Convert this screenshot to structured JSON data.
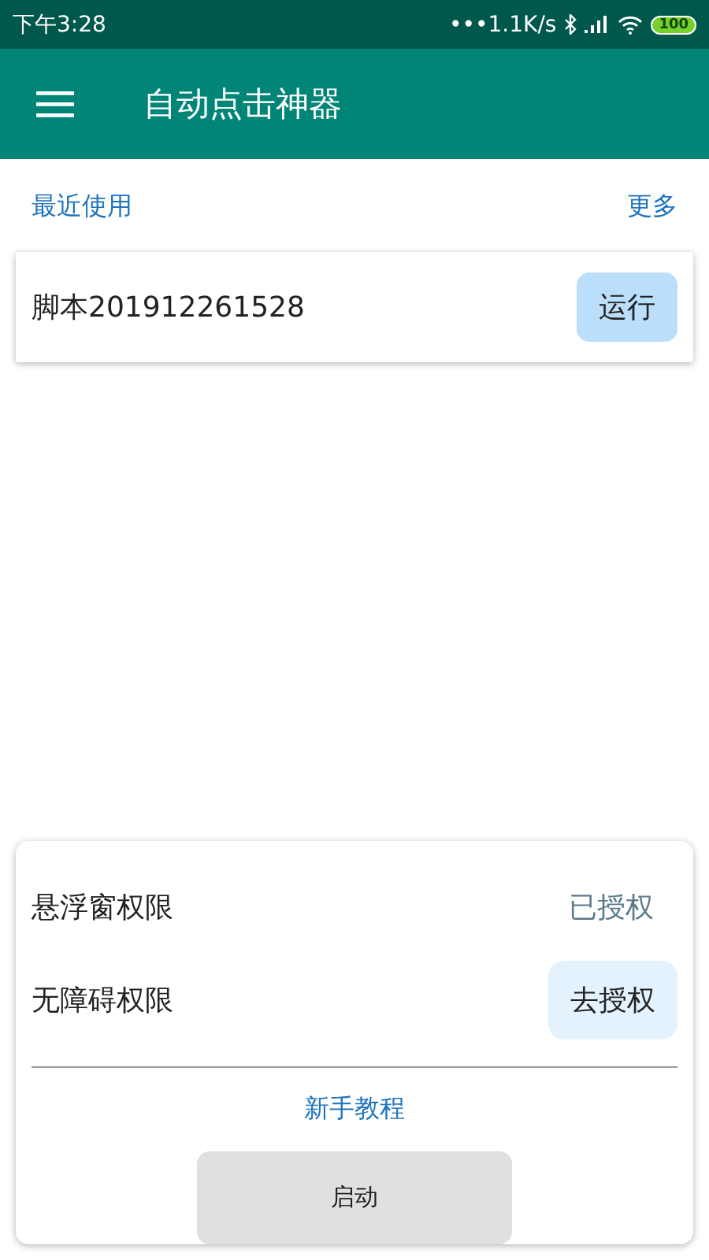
{
  "status_bar": {
    "time": "下午3:28",
    "network_speed": "•••1.1K/s",
    "battery": "100"
  },
  "app_bar": {
    "title": "自动点击神器"
  },
  "recent": {
    "heading": "最近使用",
    "more_link": "更多",
    "scripts": [
      {
        "name": "脚本201912261528",
        "action": "运行"
      }
    ]
  },
  "permissions": [
    {
      "label": "悬浮窗权限",
      "granted": true,
      "status": "已授权"
    },
    {
      "label": "无障碍权限",
      "granted": false,
      "status": "去授权"
    }
  ],
  "tutorial_link": "新手教程",
  "start_button": "启动"
}
